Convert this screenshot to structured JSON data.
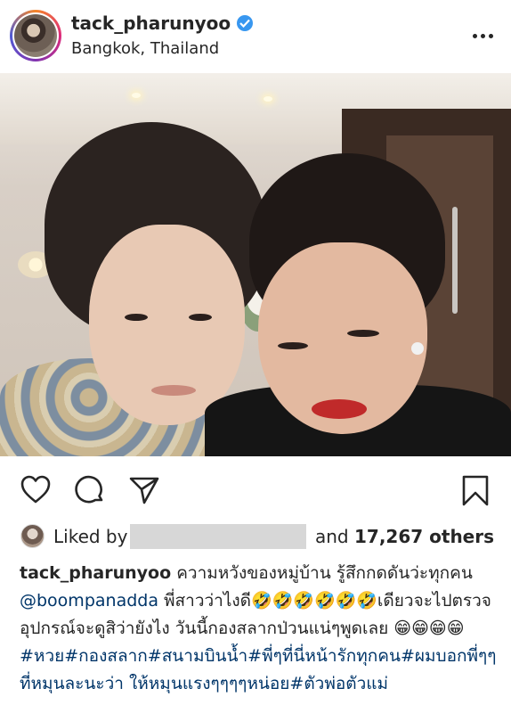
{
  "header": {
    "username": "tack_pharunyoo",
    "location": "Bangkok, Thailand",
    "verified_color": "#3897f0"
  },
  "photo": {
    "description_icon": "selfie-photo"
  },
  "actions": {
    "like_icon": "heart-icon",
    "comment_icon": "comment-icon",
    "share_icon": "share-icon",
    "save_icon": "bookmark-icon"
  },
  "likes": {
    "prefix": "Liked by",
    "suffix_pre": "and",
    "count": "17,267 others"
  },
  "caption": {
    "username": "tack_pharunyoo",
    "line1_text": " ความหวังของหมู่บ้าน รู้สึกกดดันว่ะทุกคน ",
    "mention": "@boompanadda",
    "line2_text": " พี่สาวว่าไงดี🤣🤣🤣🤣🤣🤣เดียวจะไปตรวจอุปกรณ์จะดูสิว่ายังไง วันนี้กองสลากป่วนแน่ๆพูดเลย 😁😁😁😁",
    "tags_1": "#หวย#กองสลาก#สนามบินน้ำ#พี่ๆที่นี่หน้ารักทุกคน#ผมบอกพี่ๆๆที่หมุนละนะว่า ให้หมุนแรงๆๆๆๆหน่อย#ตัวพ่อตัวแม่"
  }
}
